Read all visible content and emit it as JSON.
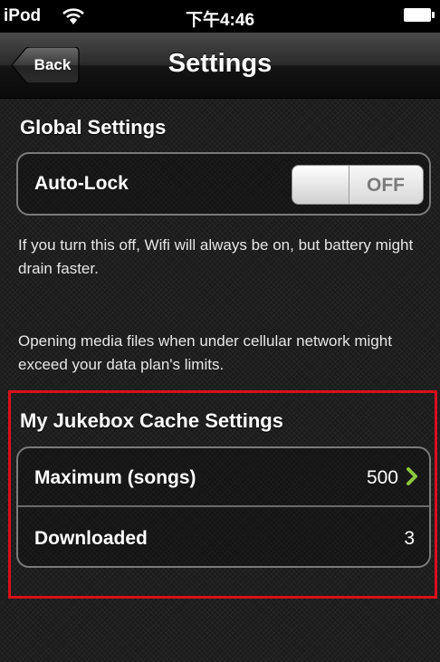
{
  "status_bar": {
    "carrier": "iPod",
    "wifi_icon": "wifi-icon",
    "time": "下午4:46",
    "battery_icon": "battery-icon"
  },
  "nav": {
    "back_label": "Back",
    "title": "Settings"
  },
  "global_settings": {
    "header": "Global Settings",
    "auto_lock": {
      "label": "Auto-Lock",
      "state": "OFF",
      "on": false
    },
    "footer1": "If you turn this off, Wifi will always be on, but battery might drain faster.",
    "footer2": "Opening media files when under cellular network might exceed your data plan's limits."
  },
  "cache_settings": {
    "header": "My Jukebox Cache Settings",
    "rows": [
      {
        "label": "Maximum (songs)",
        "value": "500",
        "disclosure": true
      },
      {
        "label": "Downloaded",
        "value": "3",
        "disclosure": false
      }
    ]
  },
  "colors": {
    "highlight": "#d8101a",
    "chevron": "#8dc63f"
  }
}
